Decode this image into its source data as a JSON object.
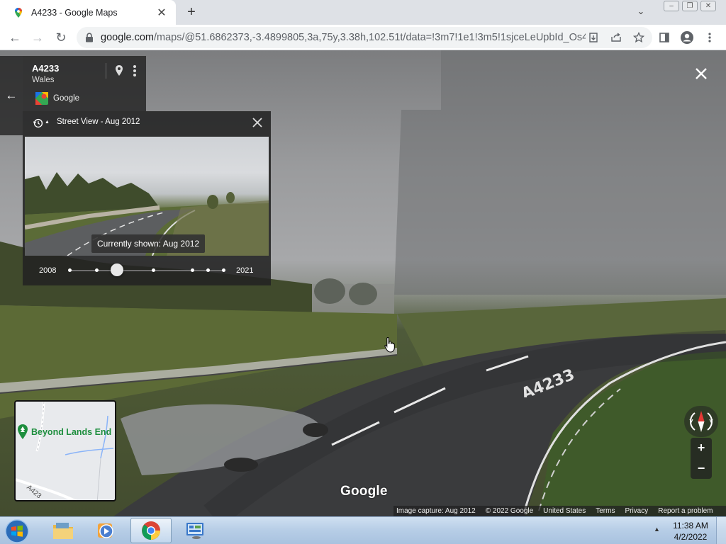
{
  "browser": {
    "tab_title": "A4233 - Google Maps",
    "url_host": "google.com",
    "url_path": "/maps/@51.6862373,-3.4899805,3a,75y,3.38h,102.51t/data=!3m7!1e1!3m5!1sjceLeUpbId_Os4a...",
    "icons": [
      "maps-favicon",
      "close-icon",
      "plus-icon",
      "chevron-down-icon",
      "back-icon",
      "forward-icon",
      "reload-icon",
      "lock-icon",
      "download-icon",
      "share-icon",
      "star-icon",
      "side-panel-icon",
      "profile-icon",
      "kebab-icon"
    ]
  },
  "location_card": {
    "title": "A4233",
    "subtitle": "Wales",
    "provider": "Google"
  },
  "time_machine": {
    "title": "Street View - Aug 2012",
    "tooltip": "Currently shown: Aug 2012",
    "year_start": "2008",
    "year_end": "2021",
    "selected_fraction": 0.31
  },
  "minimap": {
    "place_label": "Beyond Lands End",
    "road_label": "A423"
  },
  "zoom": {
    "in_label": "+",
    "out_label": "−"
  },
  "watermark": "Google",
  "footer": {
    "capture": "Image capture: Aug 2012",
    "copyright": "© 2022 Google",
    "country": "United States",
    "terms": "Terms",
    "privacy": "Privacy",
    "report": "Report a problem"
  },
  "road_marking": "A4233",
  "taskbar": {
    "time": "11:38 AM",
    "date": "4/2/2022"
  },
  "colors": {
    "accent_green": "#1e8e3e",
    "panel_bg": "#222222"
  }
}
